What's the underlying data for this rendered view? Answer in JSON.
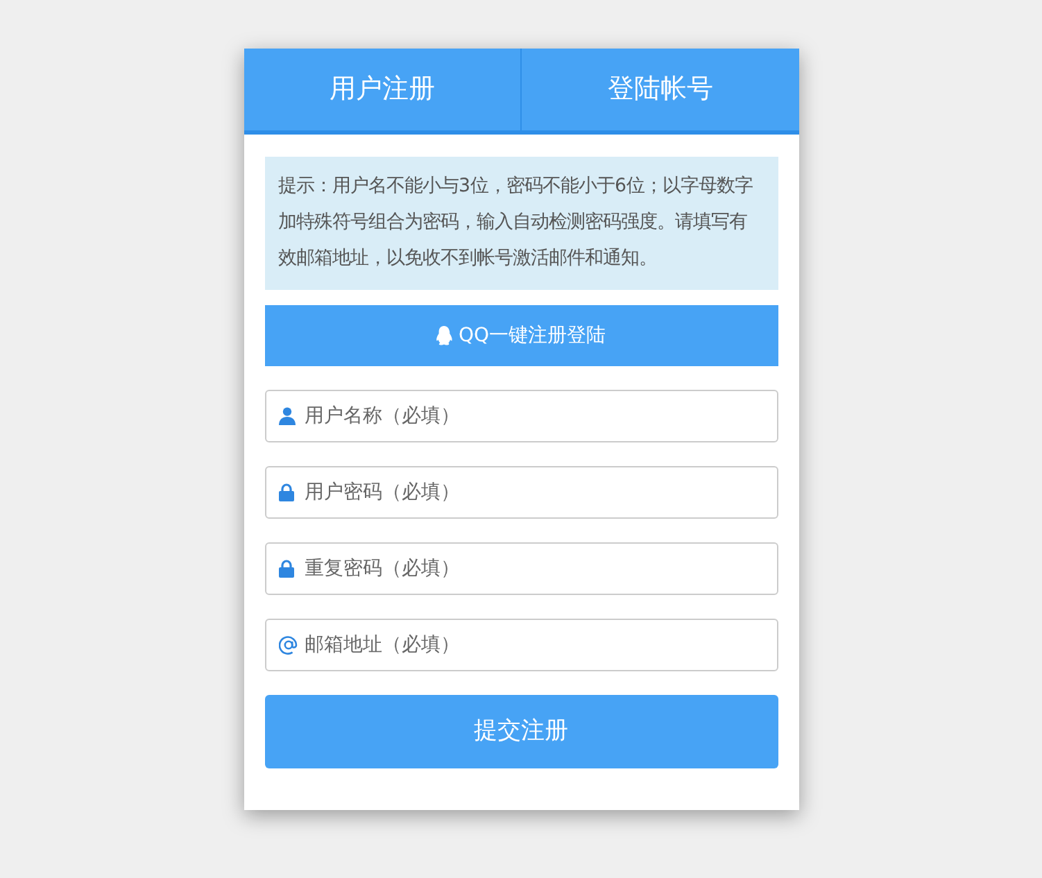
{
  "tabs": [
    {
      "label": "用户注册"
    },
    {
      "label": "登陆帐号"
    }
  ],
  "notice": "提示：用户名不能小与3位，密码不能小于6位；以字母数字加特殊符号组合为密码，输入自动检测密码强度。请填写有效邮箱地址，以免收不到帐号激活邮件和通知。",
  "qq_button": "QQ一键注册登陆",
  "fields": [
    {
      "kind": "user",
      "placeholder": "用户名称（必填）"
    },
    {
      "kind": "password",
      "placeholder": "用户密码（必填）"
    },
    {
      "kind": "password",
      "placeholder": "重复密码（必填）"
    },
    {
      "kind": "email",
      "placeholder": "邮箱地址（必填）"
    }
  ],
  "submit_button": "提交注册"
}
